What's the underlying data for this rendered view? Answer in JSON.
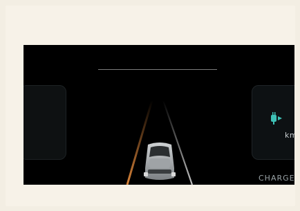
{
  "range_unit": "km",
  "drive_mode": "CHARGE",
  "icons": {
    "charge": "plug-icon",
    "vehicle": "car-icon"
  },
  "colors": {
    "screen_bg": "#000000",
    "accent_teal": "#3ec1b6",
    "lane_left": "#e48a3c",
    "lane_right": "#d9d9d9",
    "panel_bg": "#0d1113"
  }
}
